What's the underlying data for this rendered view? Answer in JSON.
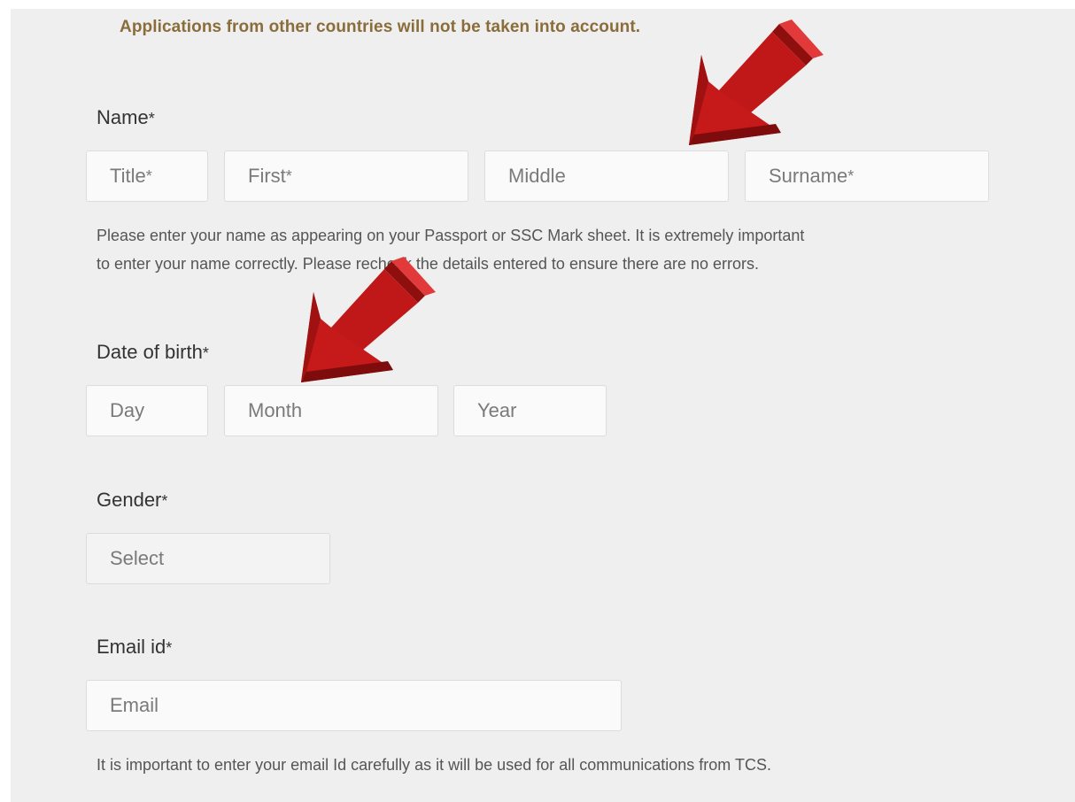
{
  "notice": "Applications from other countries will not be taken into account.",
  "name_section": {
    "label": "Name",
    "required_mark": "*",
    "fields": {
      "title": {
        "placeholder": "Title",
        "required_mark": "*"
      },
      "first": {
        "placeholder": "First",
        "required_mark": "*"
      },
      "middle": {
        "placeholder": "Middle"
      },
      "surname": {
        "placeholder": "Surname",
        "required_mark": "*"
      }
    },
    "help_line1": "Please enter your name as appearing on your Passport or SSC Mark sheet. It is extremely important",
    "help_line2": "to enter your name correctly. Please recheck the details entered to ensure there are no errors."
  },
  "dob_section": {
    "label": "Date of birth",
    "required_mark": "*",
    "fields": {
      "day": {
        "placeholder": "Day"
      },
      "month": {
        "placeholder": "Month"
      },
      "year": {
        "placeholder": "Year"
      }
    }
  },
  "gender_section": {
    "label": "Gender",
    "required_mark": "*",
    "select_value": "Select"
  },
  "email_section": {
    "label": "Email id",
    "required_mark": "*",
    "placeholder": "Email",
    "help": "It is important to enter your email Id carefully as it will be used for all communications from TCS."
  },
  "colors": {
    "panel_bg": "#efefef",
    "notice_text": "#8a6d3b",
    "arrow_red": "#c01818"
  },
  "annotations": [
    {
      "icon": "red-arrow-icon",
      "points_to": "middle-name-field"
    },
    {
      "icon": "red-arrow-icon",
      "points_to": "month-field"
    }
  ]
}
